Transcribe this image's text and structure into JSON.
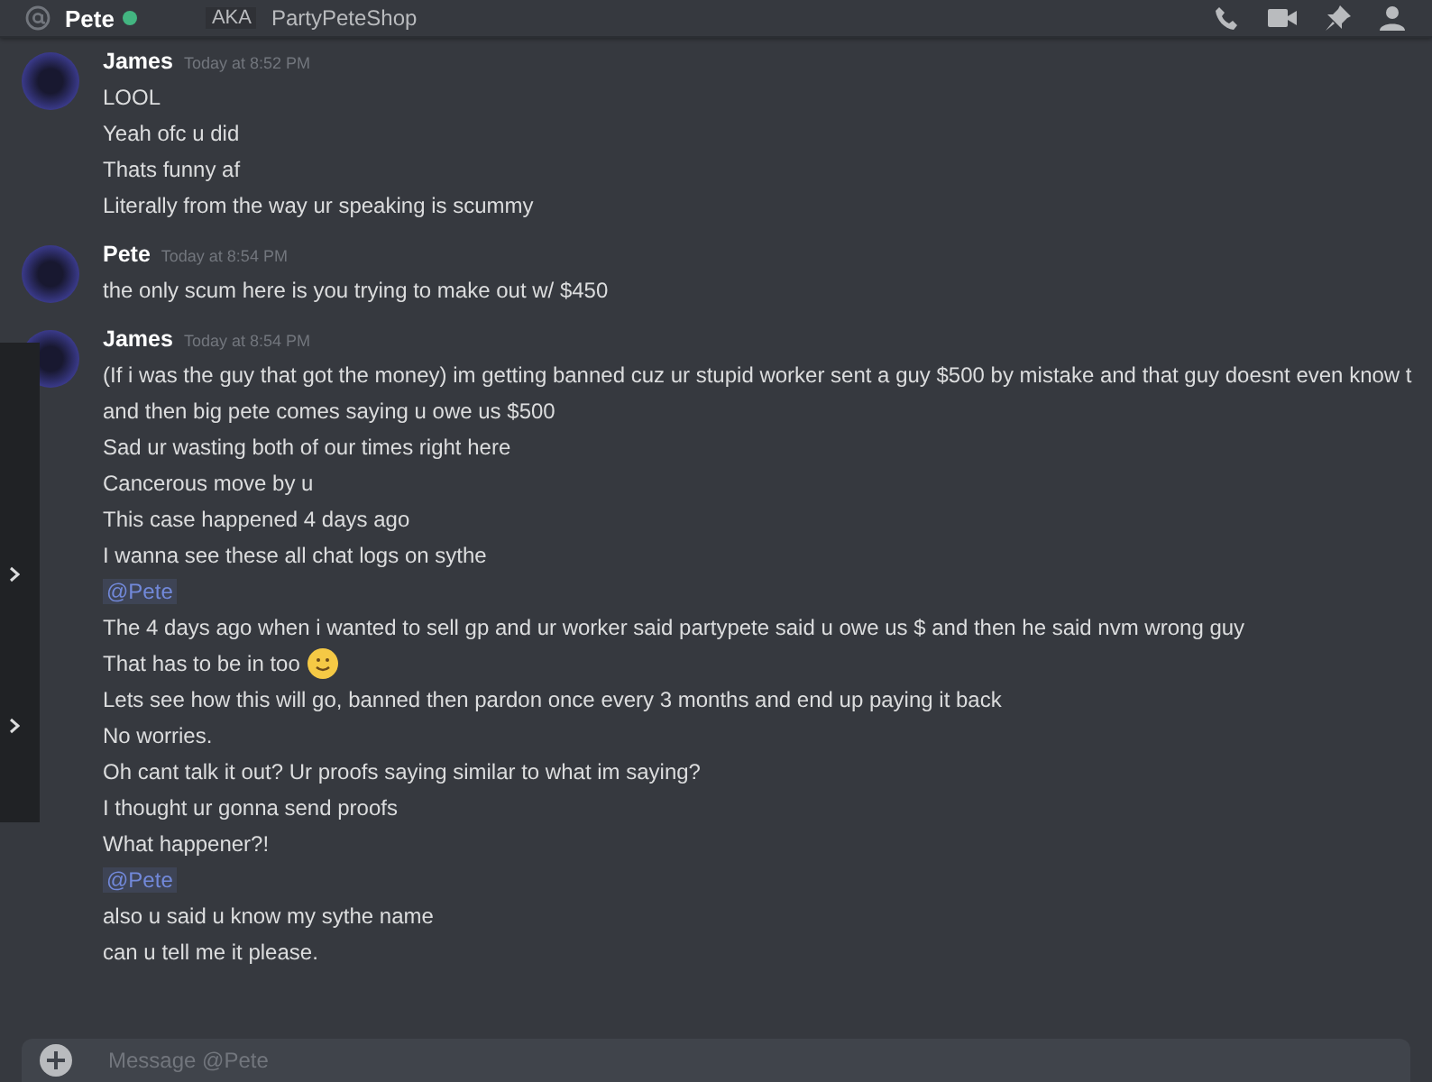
{
  "header": {
    "name": "Pete",
    "online": true,
    "tag": "AKA",
    "nickname": "PartyPeteShop"
  },
  "messages": [
    {
      "author": "James",
      "time": "Today at 8:52 PM",
      "lines": [
        {
          "kind": "text",
          "text": "LOOL"
        },
        {
          "kind": "text",
          "text": "Yeah ofc u did"
        },
        {
          "kind": "text",
          "text": "Thats funny af"
        },
        {
          "kind": "text",
          "text": "Literally from the way ur speaking is scummy"
        }
      ]
    },
    {
      "author": "Pete",
      "time": "Today at 8:54 PM",
      "lines": [
        {
          "kind": "text",
          "text": "the only scum here is you trying to make out w/ $450"
        }
      ]
    },
    {
      "author": "James",
      "time": "Today at 8:54 PM",
      "lines": [
        {
          "kind": "text",
          "text": "(If i was the guy that got the money) im getting banned cuz ur stupid worker sent a guy $500 by mistake and that guy doesnt even know t"
        },
        {
          "kind": "text",
          "text": "and then big pete comes saying u owe us $500"
        },
        {
          "kind": "text",
          "text": "Sad ur wasting both of our times right here"
        },
        {
          "kind": "text",
          "text": "Cancerous move by u"
        },
        {
          "kind": "text",
          "text": "This case happened 4 days ago"
        },
        {
          "kind": "text",
          "text": "I wanna see these all chat logs on sythe"
        },
        {
          "kind": "mention",
          "text": "@Pete"
        },
        {
          "kind": "text",
          "text": "The 4 days ago when i wanted to sell gp and ur worker said partypete said u owe us $ and then he said nvm wrong guy"
        },
        {
          "kind": "emoji",
          "text": "That has to be in too"
        },
        {
          "kind": "text",
          "text": "Lets see how this will go, banned then pardon once every 3 months and end up paying it back"
        },
        {
          "kind": "text",
          "text": "No worries."
        },
        {
          "kind": "text",
          "text": "Oh cant talk it out? Ur proofs saying similar to what im saying?"
        },
        {
          "kind": "text",
          "text": "I thought ur gonna send proofs"
        },
        {
          "kind": "text",
          "text": "What happener?!"
        },
        {
          "kind": "mention",
          "text": "@Pete"
        },
        {
          "kind": "text",
          "text": "also u said u know my sythe name"
        },
        {
          "kind": "text",
          "text": "can u tell me it please."
        }
      ]
    }
  ],
  "composer": {
    "placeholder": "Message @Pete"
  }
}
